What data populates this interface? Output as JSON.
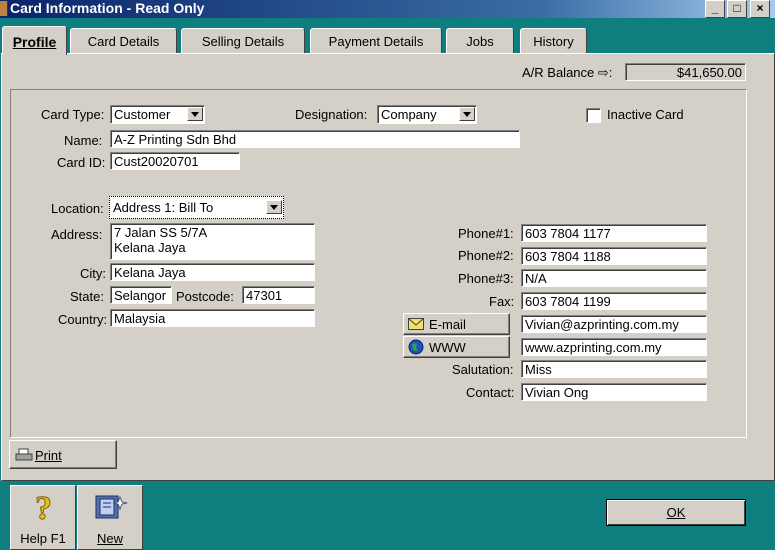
{
  "window": {
    "title": "Card Information - Read Only",
    "controls": {
      "minimize": "_",
      "maximize": "□",
      "close": "×"
    }
  },
  "tabs": [
    {
      "label": "Profile",
      "active": true
    },
    {
      "label": "Card Details",
      "active": false
    },
    {
      "label": "Selling Details",
      "active": false
    },
    {
      "label": "Payment Details",
      "active": false
    },
    {
      "label": "Jobs",
      "active": false
    },
    {
      "label": "History",
      "active": false
    }
  ],
  "ar_balance": {
    "label": "A/R Balance ⇨:",
    "value": "$41,650.00"
  },
  "card": {
    "type_label": "Card Type:",
    "type_value": "Customer",
    "designation_label": "Designation:",
    "designation_value": "Company",
    "inactive_label": "Inactive Card",
    "inactive_checked": false,
    "name_label": "Name:",
    "name_value": "A-Z Printing Sdn Bhd",
    "id_label": "Card ID:",
    "id_value": "Cust20020701"
  },
  "address": {
    "location_label": "Location:",
    "location_value": "Address 1:  Bill To",
    "address_label": "Address:",
    "address_value": "7 Jalan SS 5/7A\nKelana Jaya",
    "city_label": "City:",
    "city_value": "Kelana Jaya",
    "state_label": "State:",
    "state_value": "Selangor",
    "postcode_label": "Postcode:",
    "postcode_value": "47301",
    "country_label": "Country:",
    "country_value": "Malaysia"
  },
  "contact": {
    "phone1_label": "Phone#1:",
    "phone1_value": "603 7804 1177",
    "phone2_label": "Phone#2:",
    "phone2_value": "603 7804 1188",
    "phone3_label": "Phone#3:",
    "phone3_value": "N/A",
    "fax_label": "Fax:",
    "fax_value": "603 7804 1199",
    "email_button": "E-mail",
    "email_value": "Vivian@azprinting.com.my",
    "www_button": "WWW",
    "www_value": "www.azprinting.com.my",
    "salutation_label": "Salutation:",
    "salutation_value": "Miss",
    "contact_label": "Contact:",
    "contact_value": "Vivian Ong"
  },
  "buttons": {
    "print": "Print",
    "ok": "OK"
  },
  "toolbar": {
    "help": "Help F1",
    "new": "New"
  },
  "colors": {
    "desktop": "#0e7e7e",
    "face": "#d4d0c8",
    "titlebar": "#0a246a"
  },
  "icons": [
    "help-question-icon",
    "new-card-icon",
    "print-icon",
    "email-icon",
    "globe-icon",
    "arrow-right-icon"
  ]
}
